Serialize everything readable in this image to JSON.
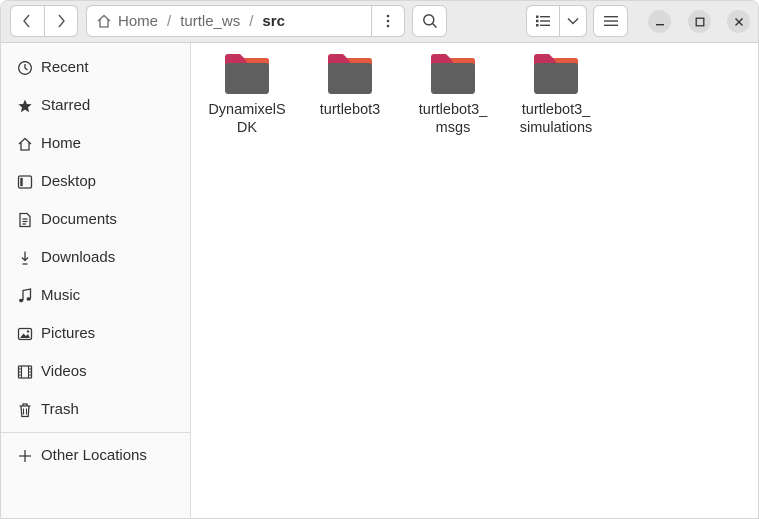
{
  "header": {
    "breadcrumbs": [
      {
        "label": "Home",
        "icon": "home-icon"
      },
      {
        "label": "turtle_ws"
      },
      {
        "label": "src"
      }
    ],
    "separator": "/"
  },
  "sidebar": {
    "items": [
      {
        "label": "Recent",
        "icon": "clock-icon"
      },
      {
        "label": "Starred",
        "icon": "star-icon"
      },
      {
        "label": "Home",
        "icon": "home-icon"
      },
      {
        "label": "Desktop",
        "icon": "desktop-icon"
      },
      {
        "label": "Documents",
        "icon": "document-icon"
      },
      {
        "label": "Downloads",
        "icon": "download-icon"
      },
      {
        "label": "Music",
        "icon": "music-icon"
      },
      {
        "label": "Pictures",
        "icon": "picture-icon"
      },
      {
        "label": "Videos",
        "icon": "video-icon"
      },
      {
        "label": "Trash",
        "icon": "trash-icon"
      }
    ],
    "other_locations": {
      "label": "Other Locations",
      "icon": "plus-icon"
    }
  },
  "files": [
    {
      "name_lines": [
        "DynamixelS",
        "DK"
      ],
      "icon": "folder-icon"
    },
    {
      "name_lines": [
        "turtlebot3"
      ],
      "icon": "folder-icon"
    },
    {
      "name_lines": [
        "turtlebot3_",
        "msgs"
      ],
      "icon": "folder-icon"
    },
    {
      "name_lines": [
        "turtlebot3_",
        "simulations"
      ],
      "icon": "folder-icon"
    }
  ],
  "colors": {
    "folder_body": "#5f5f5f",
    "folder_tab": "#c2325a",
    "folder_accent": "#e9623a",
    "headerbar": "#ebebeb",
    "sidebar": "#fafafa"
  }
}
